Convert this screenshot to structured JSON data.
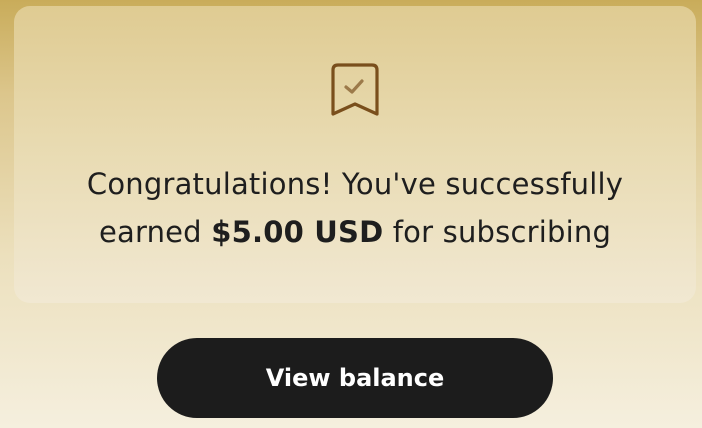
{
  "notification": {
    "icon": "bookmark-check-icon",
    "message_line1": "Congratulations! You've successfully",
    "message_prefix": "earned ",
    "amount": "$5.00 USD",
    "message_suffix": " for subscribing"
  },
  "actions": {
    "view_balance_label": "View balance"
  },
  "colors": {
    "icon": "#7a4f1c",
    "button_bg": "#1c1c1c",
    "button_text": "#ffffff",
    "text": "#1e1e1e"
  }
}
